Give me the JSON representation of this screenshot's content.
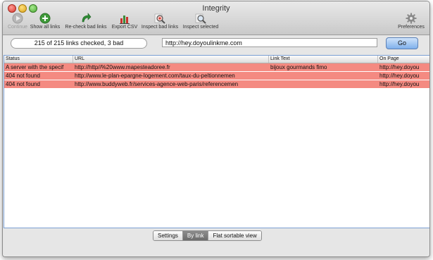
{
  "window": {
    "title": "Integrity"
  },
  "toolbar": {
    "continue_label": "Continue",
    "show_all_label": "Show all links",
    "recheck_label": "Re-check bad links",
    "export_label": "Export CSV",
    "inspect_bad_label": "Inspect bad links",
    "inspect_selected_label": "Inspect selected",
    "preferences_label": "Preferences"
  },
  "status_bar": {
    "summary": "215 of 215 links checked, 3 bad",
    "url_value": "http://hey.doyoulinkme.com",
    "go_label": "Go"
  },
  "table": {
    "columns": [
      "Status",
      "URL",
      "Link Text",
      "On Page"
    ],
    "rows": [
      {
        "status": "A server with the specif",
        "url": "http://http//%20www.mapesteadoree.fr",
        "link_text": "bijoux gourmands fimo",
        "on_page": "http://hey.doyou"
      },
      {
        "status": "404 not found",
        "url": "http://www.le-plan-epargne-logement.com/taux-du-peltionnemen",
        "link_text": "",
        "on_page": "http://hey.doyou"
      },
      {
        "status": "404 not found",
        "url": "http://www.buddyweb.fr/services-agence-web-paris/referencemen",
        "link_text": "",
        "on_page": "http://hey.doyou"
      }
    ],
    "row_color": "#f48a81"
  },
  "view_switch": {
    "options": [
      "Settings",
      "By link",
      "Flat sortable view"
    ],
    "selected": "By link"
  },
  "colors": {
    "go_button": "#7fb0ec",
    "error_row": "#f48a81"
  }
}
